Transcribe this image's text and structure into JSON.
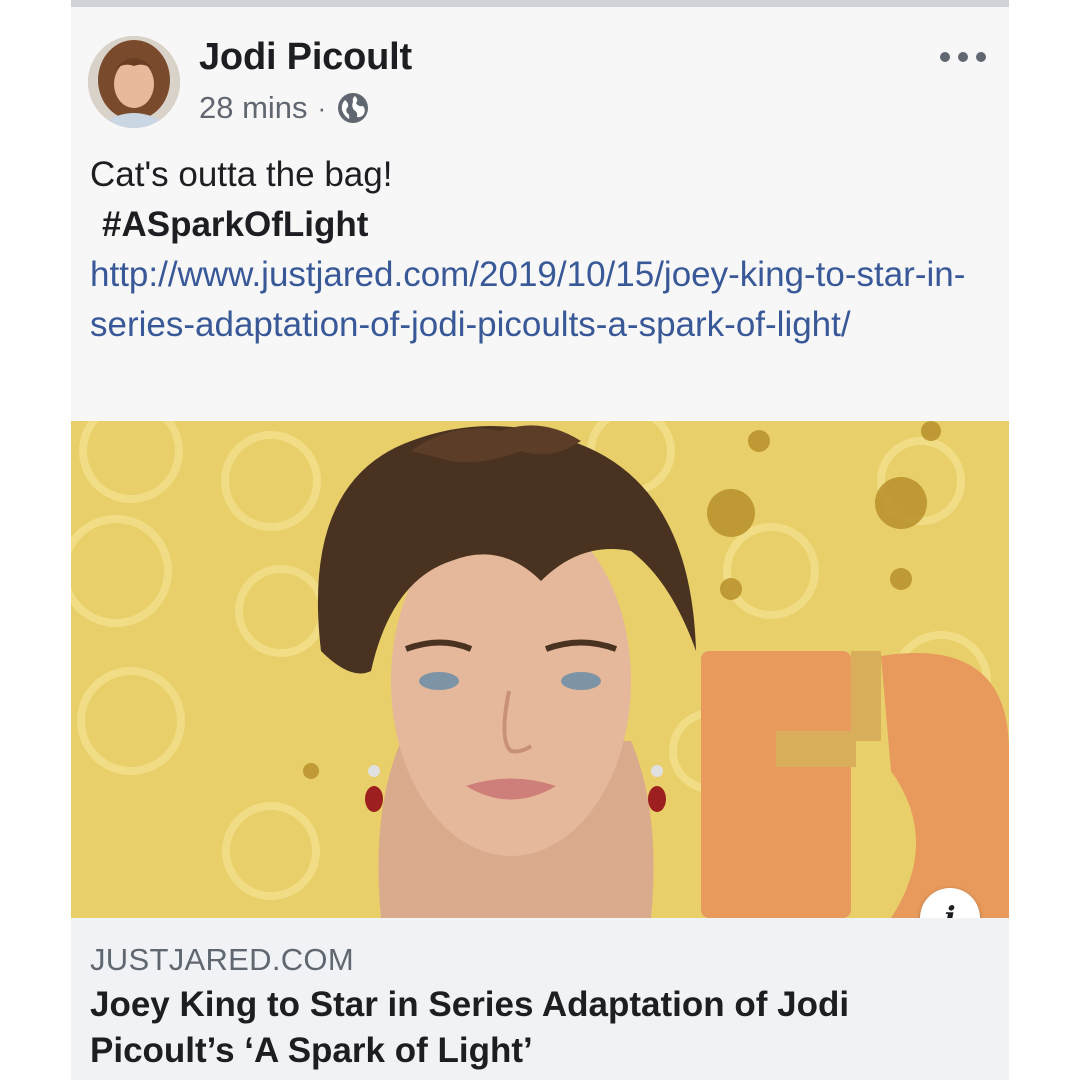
{
  "post": {
    "author": "Jodi Picoult",
    "time": "28 mins",
    "separator": "·",
    "audience_icon": "globe-icon",
    "more_icon": "more-options-icon",
    "text_line1": "Cat's outta the bag!",
    "hashtag": "#ASparkOfLight",
    "link_url": "http://www.justjared.com/2019/10/15/joey-king-to-star-in-series-adaptation-of-jodi-picoults-a-spark-of-light/"
  },
  "link_preview": {
    "domain": "JUSTJARED.COM",
    "title": "Joey King to Star in Series Adaptation of Jodi Picoult’s ‘A Spark of Light’",
    "info_icon": "info-icon",
    "info_glyph": "i"
  },
  "colors": {
    "link": "#385898",
    "text": "#1c1e21",
    "meta": "#606770",
    "photo_background": "#e8cf6a"
  }
}
